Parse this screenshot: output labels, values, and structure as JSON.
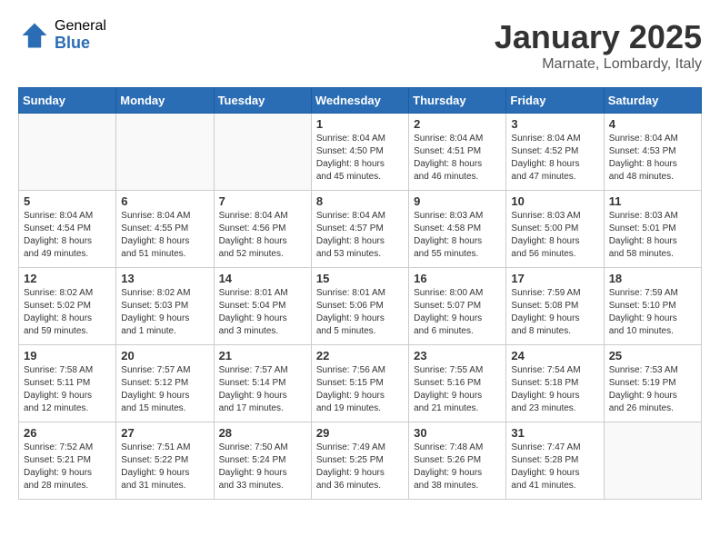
{
  "logo": {
    "general": "General",
    "blue": "Blue"
  },
  "title": "January 2025",
  "subtitle": "Marnate, Lombardy, Italy",
  "weekdays": [
    "Sunday",
    "Monday",
    "Tuesday",
    "Wednesday",
    "Thursday",
    "Friday",
    "Saturday"
  ],
  "weeks": [
    [
      {
        "day": "",
        "info": ""
      },
      {
        "day": "",
        "info": ""
      },
      {
        "day": "",
        "info": ""
      },
      {
        "day": "1",
        "info": "Sunrise: 8:04 AM\nSunset: 4:50 PM\nDaylight: 8 hours\nand 45 minutes."
      },
      {
        "day": "2",
        "info": "Sunrise: 8:04 AM\nSunset: 4:51 PM\nDaylight: 8 hours\nand 46 minutes."
      },
      {
        "day": "3",
        "info": "Sunrise: 8:04 AM\nSunset: 4:52 PM\nDaylight: 8 hours\nand 47 minutes."
      },
      {
        "day": "4",
        "info": "Sunrise: 8:04 AM\nSunset: 4:53 PM\nDaylight: 8 hours\nand 48 minutes."
      }
    ],
    [
      {
        "day": "5",
        "info": "Sunrise: 8:04 AM\nSunset: 4:54 PM\nDaylight: 8 hours\nand 49 minutes."
      },
      {
        "day": "6",
        "info": "Sunrise: 8:04 AM\nSunset: 4:55 PM\nDaylight: 8 hours\nand 51 minutes."
      },
      {
        "day": "7",
        "info": "Sunrise: 8:04 AM\nSunset: 4:56 PM\nDaylight: 8 hours\nand 52 minutes."
      },
      {
        "day": "8",
        "info": "Sunrise: 8:04 AM\nSunset: 4:57 PM\nDaylight: 8 hours\nand 53 minutes."
      },
      {
        "day": "9",
        "info": "Sunrise: 8:03 AM\nSunset: 4:58 PM\nDaylight: 8 hours\nand 55 minutes."
      },
      {
        "day": "10",
        "info": "Sunrise: 8:03 AM\nSunset: 5:00 PM\nDaylight: 8 hours\nand 56 minutes."
      },
      {
        "day": "11",
        "info": "Sunrise: 8:03 AM\nSunset: 5:01 PM\nDaylight: 8 hours\nand 58 minutes."
      }
    ],
    [
      {
        "day": "12",
        "info": "Sunrise: 8:02 AM\nSunset: 5:02 PM\nDaylight: 8 hours\nand 59 minutes."
      },
      {
        "day": "13",
        "info": "Sunrise: 8:02 AM\nSunset: 5:03 PM\nDaylight: 9 hours\nand 1 minute."
      },
      {
        "day": "14",
        "info": "Sunrise: 8:01 AM\nSunset: 5:04 PM\nDaylight: 9 hours\nand 3 minutes."
      },
      {
        "day": "15",
        "info": "Sunrise: 8:01 AM\nSunset: 5:06 PM\nDaylight: 9 hours\nand 5 minutes."
      },
      {
        "day": "16",
        "info": "Sunrise: 8:00 AM\nSunset: 5:07 PM\nDaylight: 9 hours\nand 6 minutes."
      },
      {
        "day": "17",
        "info": "Sunrise: 7:59 AM\nSunset: 5:08 PM\nDaylight: 9 hours\nand 8 minutes."
      },
      {
        "day": "18",
        "info": "Sunrise: 7:59 AM\nSunset: 5:10 PM\nDaylight: 9 hours\nand 10 minutes."
      }
    ],
    [
      {
        "day": "19",
        "info": "Sunrise: 7:58 AM\nSunset: 5:11 PM\nDaylight: 9 hours\nand 12 minutes."
      },
      {
        "day": "20",
        "info": "Sunrise: 7:57 AM\nSunset: 5:12 PM\nDaylight: 9 hours\nand 15 minutes."
      },
      {
        "day": "21",
        "info": "Sunrise: 7:57 AM\nSunset: 5:14 PM\nDaylight: 9 hours\nand 17 minutes."
      },
      {
        "day": "22",
        "info": "Sunrise: 7:56 AM\nSunset: 5:15 PM\nDaylight: 9 hours\nand 19 minutes."
      },
      {
        "day": "23",
        "info": "Sunrise: 7:55 AM\nSunset: 5:16 PM\nDaylight: 9 hours\nand 21 minutes."
      },
      {
        "day": "24",
        "info": "Sunrise: 7:54 AM\nSunset: 5:18 PM\nDaylight: 9 hours\nand 23 minutes."
      },
      {
        "day": "25",
        "info": "Sunrise: 7:53 AM\nSunset: 5:19 PM\nDaylight: 9 hours\nand 26 minutes."
      }
    ],
    [
      {
        "day": "26",
        "info": "Sunrise: 7:52 AM\nSunset: 5:21 PM\nDaylight: 9 hours\nand 28 minutes."
      },
      {
        "day": "27",
        "info": "Sunrise: 7:51 AM\nSunset: 5:22 PM\nDaylight: 9 hours\nand 31 minutes."
      },
      {
        "day": "28",
        "info": "Sunrise: 7:50 AM\nSunset: 5:24 PM\nDaylight: 9 hours\nand 33 minutes."
      },
      {
        "day": "29",
        "info": "Sunrise: 7:49 AM\nSunset: 5:25 PM\nDaylight: 9 hours\nand 36 minutes."
      },
      {
        "day": "30",
        "info": "Sunrise: 7:48 AM\nSunset: 5:26 PM\nDaylight: 9 hours\nand 38 minutes."
      },
      {
        "day": "31",
        "info": "Sunrise: 7:47 AM\nSunset: 5:28 PM\nDaylight: 9 hours\nand 41 minutes."
      },
      {
        "day": "",
        "info": ""
      }
    ]
  ]
}
